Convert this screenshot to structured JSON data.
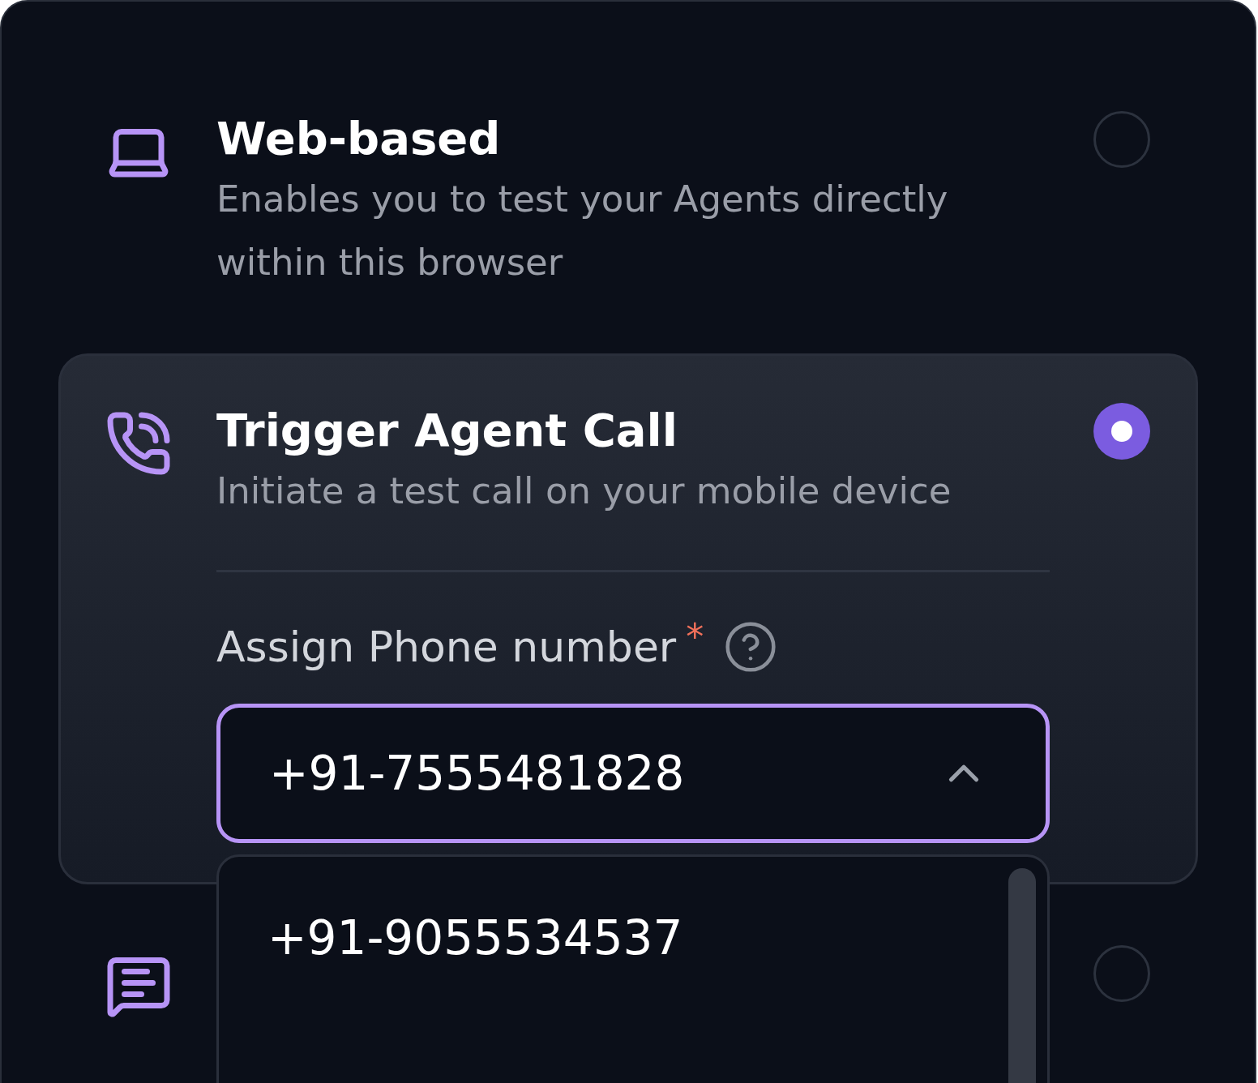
{
  "options": [
    {
      "kind": "laptop",
      "title": "Web-based",
      "description": "Enables you to test your Agents directly within this browser",
      "selected": false
    },
    {
      "kind": "phone",
      "title": "Trigger Agent Call",
      "description": "Initiate a test call on your mobile device",
      "selected": true,
      "phone_field": {
        "label": "Assign Phone number",
        "required": "*",
        "value": "+91-7555481828",
        "expanded": true,
        "dropdown_options": [
          {
            "label": "+91-9055534537"
          }
        ]
      }
    },
    {
      "kind": "message",
      "selected": false
    }
  ]
}
